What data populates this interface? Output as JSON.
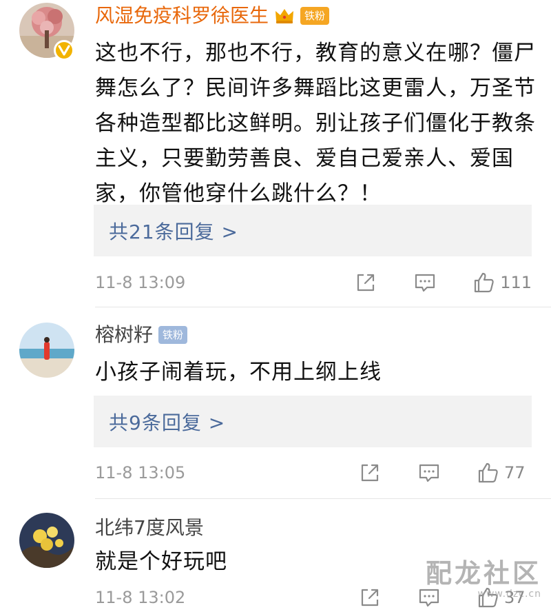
{
  "comments": [
    {
      "username": "风湿免疫科罗徐医生",
      "fan_badge": "铁粉",
      "text": "这也不行，那也不行，教育的意义在哪？僵尸舞怎么了？民间许多舞蹈比这更雷人，万圣节各种造型都比这鲜明。别让孩子们僵化于教条主义，只要勤劳善良、爱自己爱亲人、爱国家，你管他穿什么跳什么？！",
      "replies_label": "共21条回复 >",
      "timestamp": "11-8 13:09",
      "likes": "111",
      "verified": true,
      "vip_crown": true,
      "name_color": "#e8670a",
      "badge_color": "#f5a623"
    },
    {
      "username": "榕树籽",
      "fan_badge": "铁粉",
      "text": "小孩子闹着玩，不用上纲上线",
      "replies_label": "共9条回复 >",
      "timestamp": "11-8 13:05",
      "likes": "77",
      "badge_color": "#9fb8dc"
    },
    {
      "username": "北纬7度风景",
      "text": "就是个好玩吧",
      "timestamp": "11-8 13:02",
      "likes": "37"
    }
  ],
  "watermark": {
    "text": "配龙社区",
    "url": "www.dzc.cn"
  },
  "icons": {
    "share": "share-icon",
    "comment": "comment-icon",
    "like": "thumbs-up-icon",
    "crown": "crown-icon",
    "verified": "verified-v-icon"
  },
  "colors": {
    "link": "#4b6a9b",
    "reply_bg": "#f2f2f2",
    "meta": "#9a9a9a"
  }
}
